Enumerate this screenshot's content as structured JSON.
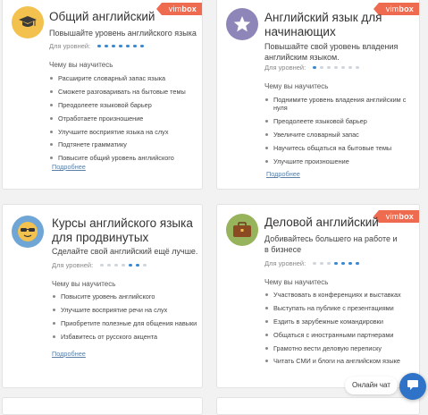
{
  "cards": [
    {
      "title": "Общий английский",
      "subtitle": "Повышайте уровень английского языка",
      "badge": "vimbox",
      "level_label": "Для уровней:",
      "levels_active": [
        true,
        true,
        true,
        true,
        true,
        true,
        true
      ],
      "learn_heading": "Чему вы научитесь",
      "items": [
        "Расширите словарный запас языка",
        "Сможете разговаривать на бытовые темы",
        "Преодолеете языковой барьер",
        "Отработаете произношение",
        "Улучшите восприятие языка на слух",
        "Подтянете грамматику",
        "Повысите общий уровень английского"
      ],
      "more": "Подробнее",
      "icon": "graduation-cap-icon",
      "icon_bg": "#f2c14e"
    },
    {
      "title": "Английский язык для начинающих",
      "subtitle": "Повышайте свой уровень владения английским языком.",
      "badge": "vimbox",
      "level_label": "Для уровней:",
      "levels_active": [
        true,
        false,
        false,
        false,
        false,
        false,
        false
      ],
      "learn_heading": "Чему вы научитесь",
      "items": [
        "Поднимите уровень владения английским с нуля",
        "Преодолеете языковой барьер",
        "Увеличите словарный запас",
        "Научитесь общаться на бытовые темы",
        "Улучшите произношение"
      ],
      "more": "Подробнее",
      "icon": "star-icon",
      "icon_bg": "#8e86b8"
    },
    {
      "title": "Курсы английского языка для продвинутых",
      "subtitle": "Сделайте свой английский ещё лучше.",
      "badge": "",
      "level_label": "Для уровней:",
      "levels_active": [
        false,
        false,
        false,
        false,
        true,
        true,
        false
      ],
      "learn_heading": "Чему вы научитесь",
      "items": [
        "Повысите уровень английского",
        "Улучшите восприятие речи на слух",
        "Приобретите полезные для общения навыки",
        "Избавитесь от русского акцента"
      ],
      "more": "Подробнее",
      "icon": "sunglasses-face-icon",
      "icon_bg": "#6fa6d6"
    },
    {
      "title": "Деловой английский",
      "subtitle": "Добивайтесь большего на работе и в бизнесе",
      "badge": "vimbox",
      "level_label": "Для уровней:",
      "levels_active": [
        false,
        false,
        false,
        true,
        true,
        true,
        true
      ],
      "learn_heading": "Чему вы научитесь",
      "items": [
        "Участвовать в конференциях и выставках",
        "Выступать на публике с презентациями",
        "Ездить в зарубежные командировки",
        "Общаться с иностранными партнерами",
        "Грамотно вести деловую переписку",
        "Читать СМИ и блоги на английском языке"
      ],
      "more": "Подробнее",
      "icon": "briefcase-icon",
      "icon_bg": "#97b35b"
    }
  ],
  "chat": {
    "label": "Онлайн чат",
    "icon": "chat-bubble-icon",
    "color": "#2f73c8"
  }
}
